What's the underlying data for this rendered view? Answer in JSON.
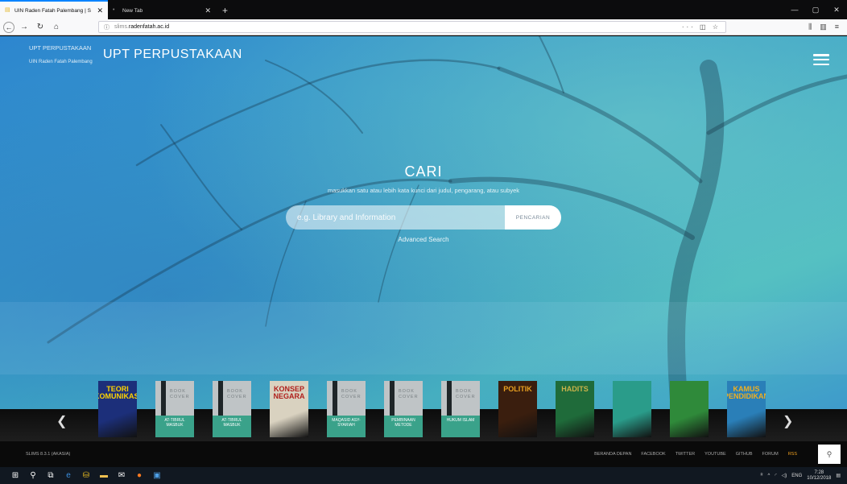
{
  "browser": {
    "tabs": [
      {
        "title": "UIN Raden Fatah Palembang | S",
        "active": true,
        "favicon": "book-icon"
      },
      {
        "title": "New Tab",
        "active": false
      }
    ],
    "url": {
      "host": "slims.",
      "domain": "radenfatah.ac.id"
    },
    "new_tab_label": "+"
  },
  "site": {
    "brand_small": "UPT PERPUSTAKAAN",
    "brand_sub": "UIN Raden Fatah Palembang",
    "brand_big": "UPT PERPUSTAKAAN",
    "search": {
      "heading": "CARI",
      "hint": "masukkan satu atau lebih kata kunci dari judul, pengarang, atau subyek",
      "placeholder": "e.g. Library and Information",
      "button": "PENCARIAN",
      "advanced": "Advanced Search"
    },
    "books": [
      {
        "title": "TEORI KOMUNIKASI",
        "kind": "cover",
        "color": "#1c2f7a",
        "accent": "#ffd400"
      },
      {
        "title": "AT-TIBRUL MASBUK",
        "kind": "placeholder"
      },
      {
        "title": "AT-TIBRUL MASBUK",
        "kind": "placeholder"
      },
      {
        "title": "KONSEP NEGARA",
        "kind": "cover",
        "color": "#d9d2c0",
        "accent": "#b0201c"
      },
      {
        "title": "MAQASID ASY-SYARIAH",
        "kind": "placeholder"
      },
      {
        "title": "PEMBINAAN METODE",
        "kind": "placeholder"
      },
      {
        "title": "HUKUM ISLAM",
        "kind": "placeholder"
      },
      {
        "title": "POLITIK",
        "kind": "cover",
        "color": "#3a1e0e",
        "accent": "#e8a020"
      },
      {
        "title": "HADITS",
        "kind": "cover",
        "color": "#1f6b3a",
        "accent": "#c9b34a"
      },
      {
        "title": "",
        "kind": "cover",
        "color": "#2a9c8a",
        "accent": "#e8e080"
      },
      {
        "title": "",
        "kind": "cover",
        "color": "#2f8a3a",
        "accent": "#d9c24a"
      },
      {
        "title": "KAMUS PENDIDIKAN",
        "kind": "cover",
        "color": "#2a7fb8",
        "accent": "#f0b020"
      }
    ],
    "book_word": "BOOK COVER",
    "footer": {
      "version": "SLIMS 8.3.1 (AKASIA)",
      "links": [
        "BERANDA DEPAN",
        "FACEBOOK",
        "TWITTER",
        "YOUTUBE",
        "GITHUB",
        "FORUM",
        "RSS"
      ]
    }
  },
  "taskbar": {
    "lang": "ENG",
    "time": "7:28",
    "date": "10/12/2018"
  }
}
